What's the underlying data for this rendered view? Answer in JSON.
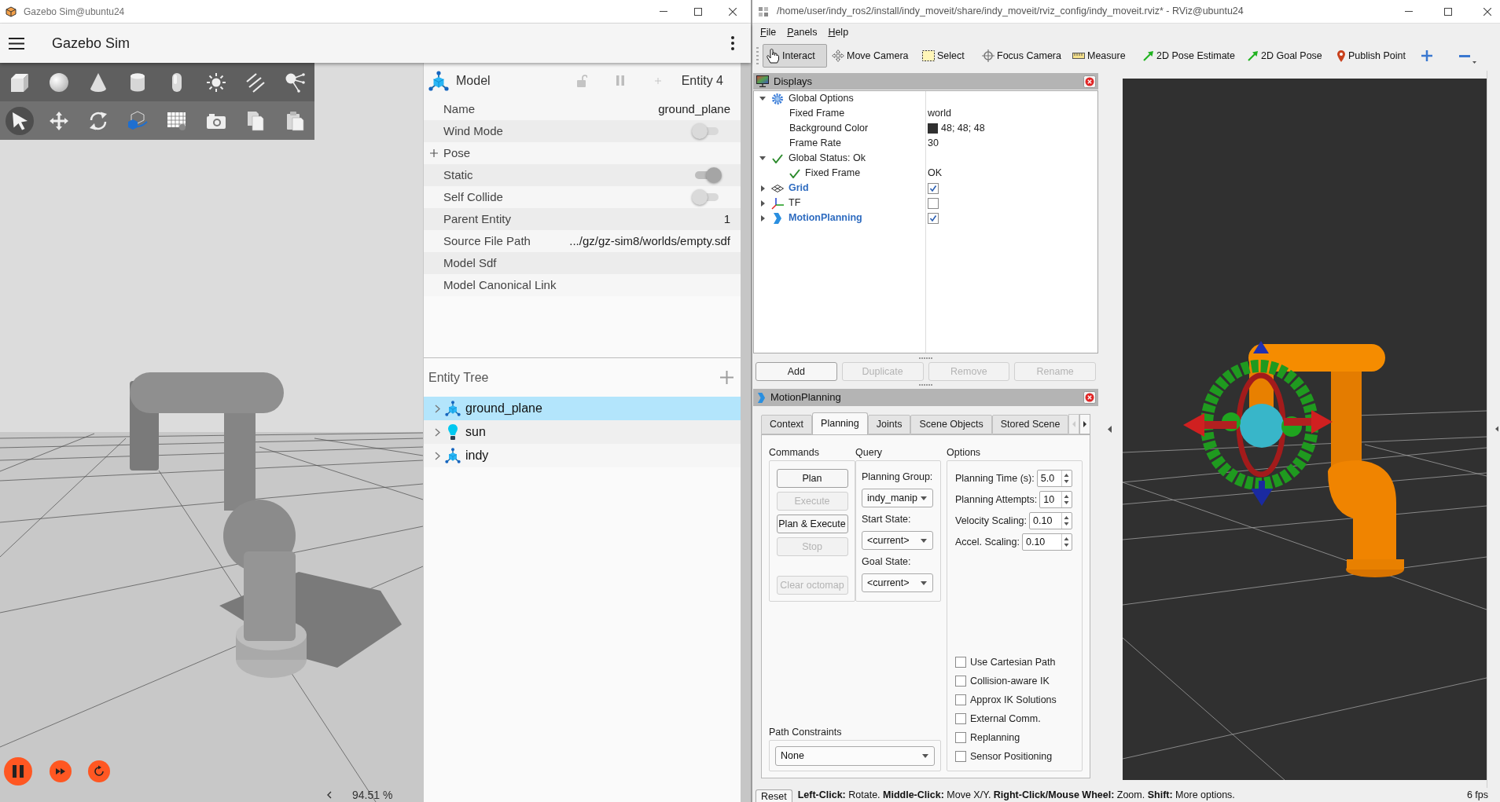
{
  "gazebo": {
    "window": {
      "title": "Gazebo Sim@ubuntu24"
    },
    "header": {
      "title": "Gazebo Sim"
    },
    "transform_tools": [
      {
        "selected": true
      },
      {
        "selected": false
      },
      {
        "selected": false
      },
      {
        "selected": false
      },
      {
        "selected": false
      },
      {
        "selected": false
      },
      {
        "selected": false
      },
      {
        "selected": false
      }
    ],
    "model_panel": {
      "title": "Model",
      "entity": "Entity 4",
      "rows": [
        {
          "kind": "text",
          "label": "Name",
          "value": "ground_plane"
        },
        {
          "kind": "toggle",
          "label": "Wind Mode",
          "on": false
        },
        {
          "kind": "expandable",
          "label": "Pose",
          "expanded": false
        },
        {
          "kind": "toggle",
          "label": "Static",
          "on": true
        },
        {
          "kind": "toggle",
          "label": "Self Collide",
          "on": false
        },
        {
          "kind": "text",
          "label": "Parent Entity",
          "value": "1"
        },
        {
          "kind": "text",
          "label": "Source File Path",
          "value": ".../gz/gz-sim8/worlds/empty.sdf"
        },
        {
          "kind": "label",
          "label": "Model Sdf"
        },
        {
          "kind": "label",
          "label": "Model Canonical Link"
        }
      ]
    },
    "entity_tree": {
      "title": "Entity Tree",
      "items": [
        {
          "kind": "model",
          "name": "ground_plane",
          "selected": true,
          "expanded": false
        },
        {
          "kind": "light",
          "name": "sun",
          "selected": false,
          "expanded": false
        },
        {
          "kind": "model",
          "name": "indy",
          "selected": false,
          "expanded": false
        }
      ]
    },
    "playback": {
      "paused": false,
      "rtf": "94.51 %"
    }
  },
  "rviz": {
    "window": {
      "title": "/home/user/indy_ros2/install/indy_moveit/share/indy_moveit/rviz_config/indy_moveit.rviz* - RViz@ubuntu24"
    },
    "menu": [
      "File",
      "Panels",
      "Help"
    ],
    "tools": [
      {
        "label": "Interact",
        "selected": true
      },
      {
        "label": "Move Camera",
        "selected": false
      },
      {
        "label": "Select",
        "selected": false
      },
      {
        "label": "Focus Camera",
        "selected": false
      },
      {
        "label": "Measure",
        "selected": false
      },
      {
        "label": "2D Pose Estimate",
        "selected": false
      },
      {
        "label": "2D Goal Pose",
        "selected": false
      },
      {
        "label": "Publish Point",
        "selected": false
      }
    ],
    "displays": {
      "title": "Displays",
      "tree": [
        {
          "kind": "options",
          "label": "Global Options",
          "expanded": true,
          "children": [
            {
              "kind": "property",
              "label": "Fixed Frame",
              "value": "world"
            },
            {
              "kind": "color",
              "label": "Background Color",
              "value": "48; 48; 48",
              "color": "#303030"
            },
            {
              "kind": "property",
              "label": "Frame Rate",
              "value": "30"
            }
          ]
        },
        {
          "kind": "status",
          "label": "Global Status: Ok",
          "expanded": true,
          "children": [
            {
              "kind": "status",
              "label": "Fixed Frame",
              "value": "OK"
            }
          ]
        },
        {
          "kind": "grid",
          "label": "Grid",
          "expanded": false,
          "checked": true
        },
        {
          "kind": "tf",
          "label": "TF",
          "expanded": false,
          "checked": false
        },
        {
          "kind": "plugin",
          "label": "MotionPlanning",
          "expanded": false,
          "checked": true
        }
      ],
      "buttons": [
        {
          "label": "Add",
          "disabled": false
        },
        {
          "label": "Duplicate",
          "disabled": true
        },
        {
          "label": "Remove",
          "disabled": true
        },
        {
          "label": "Rename",
          "disabled": true
        }
      ]
    },
    "motion_planning": {
      "title": "MotionPlanning",
      "tabs": [
        {
          "label": "Context",
          "selected": false
        },
        {
          "label": "Planning",
          "selected": true
        },
        {
          "label": "Joints",
          "selected": false
        },
        {
          "label": "Scene Objects",
          "selected": false
        },
        {
          "label": "Stored Scene",
          "selected": false
        }
      ],
      "commands": {
        "title": "Commands",
        "buttons": [
          {
            "label": "Plan",
            "disabled": false
          },
          {
            "label": "Execute",
            "disabled": true
          },
          {
            "label": "Plan & Execute",
            "disabled": false
          },
          {
            "label": "Stop",
            "disabled": true
          },
          {
            "label": "Clear octomap",
            "disabled": true
          }
        ]
      },
      "query": {
        "title": "Query",
        "fields": [
          {
            "label": "Planning Group:",
            "value": "indy_manip"
          },
          {
            "label": "Start State:",
            "value": "<current>"
          },
          {
            "label": "Goal State:",
            "value": "<current>"
          }
        ]
      },
      "options": {
        "title": "Options",
        "spinboxes": [
          {
            "label": "Planning Time (s):",
            "value": "5.0"
          },
          {
            "label": "Planning Attempts:",
            "value": "10"
          },
          {
            "label": "Velocity Scaling:",
            "value": "0.10"
          },
          {
            "label": "Accel. Scaling:",
            "value": "0.10"
          }
        ],
        "checkboxes": [
          {
            "label": "Use Cartesian Path",
            "checked": false
          },
          {
            "label": "Collision-aware IK",
            "checked": false
          },
          {
            "label": "Approx IK Solutions",
            "checked": false
          },
          {
            "label": "External Comm.",
            "checked": false
          },
          {
            "label": "Replanning",
            "checked": false
          },
          {
            "label": "Sensor Positioning",
            "checked": false
          }
        ]
      },
      "path_constraints": {
        "label": "Path Constraints",
        "value": "None"
      }
    },
    "status_bar": {
      "reset": "Reset",
      "hint": "**Left-Click:** Rotate. **Middle-Click:** Move X/Y. **Right-Click/Mouse Wheel:** Zoom. **Shift:** More options.",
      "fps": "6 fps"
    }
  }
}
